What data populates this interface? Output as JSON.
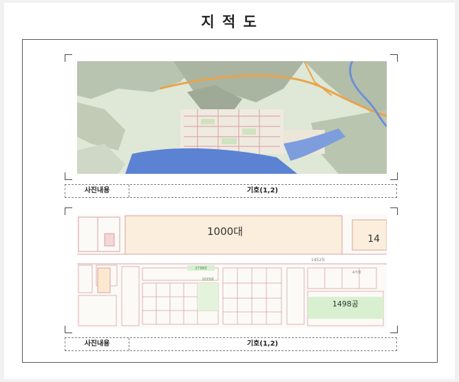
{
  "document": {
    "title": "지  적  도"
  },
  "panels": [
    {
      "caption_label": "사진내용",
      "caption_value": "기호(1,2)"
    },
    {
      "caption_label": "사진내용",
      "caption_value": "기호(1,2)",
      "map_labels": {
        "parcel_main": "1000대",
        "parcel_right": "14",
        "parcel_bottom": "1498공",
        "road_label": "1452도",
        "small_label": "2738대",
        "side_label": "4기대",
        "mid_label": "1015대"
      }
    }
  ]
}
